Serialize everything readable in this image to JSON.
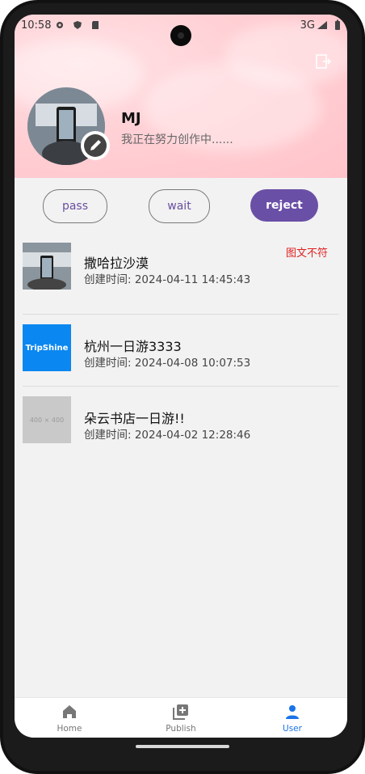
{
  "status_bar": {
    "time": "10:58",
    "network": "3G"
  },
  "profile": {
    "name": "MJ",
    "signature": "我正在努力创作中......"
  },
  "filters": {
    "pass": "pass",
    "wait": "wait",
    "reject": "reject",
    "active": "reject"
  },
  "list": [
    {
      "title": "撒哈拉沙漠",
      "date": "创建时间: 2024-04-11 14:45:43",
      "reason": "图文不符"
    },
    {
      "title": "杭州一日游3333",
      "date": "创建时间: 2024-04-08 10:07:53",
      "reason": "",
      "thumb_label": "TripShine"
    },
    {
      "title": "朵云书店一日游!!",
      "date": "创建时间: 2024-04-02 12:28:46",
      "reason": "",
      "thumb_label": "400 × 400"
    }
  ],
  "bottom_nav": {
    "home": "Home",
    "publish": "Publish",
    "user": "User",
    "active": "User"
  },
  "colors": {
    "accent": "#6a4fa6",
    "reject_text": "#e02020",
    "nav_active": "#1a73e8"
  }
}
